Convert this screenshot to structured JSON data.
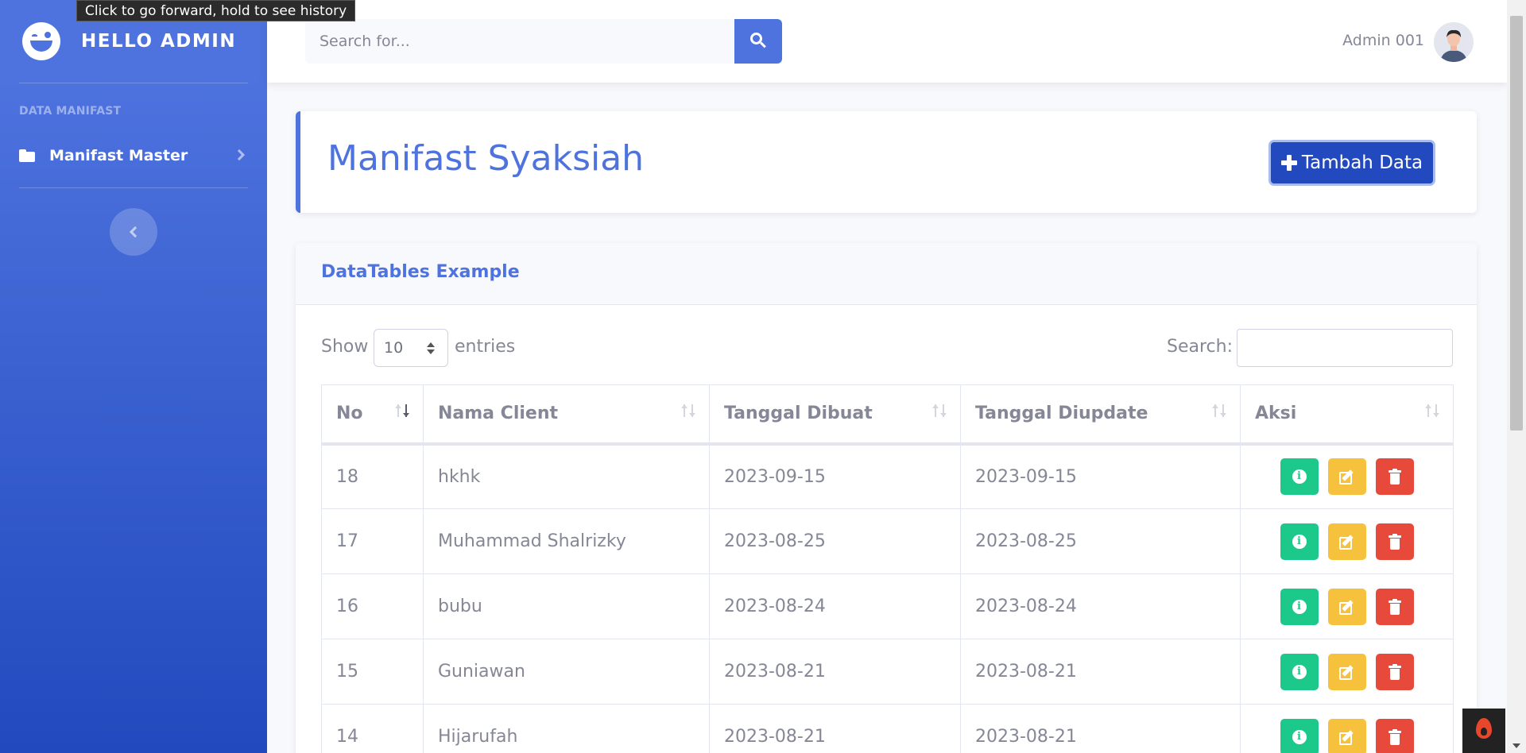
{
  "tooltip": "Click to go forward, hold to see history",
  "sidebar": {
    "brand": "HELLO ADMIN",
    "heading": "DATA MANIFAST",
    "items": [
      {
        "label": "Manifast Master"
      }
    ]
  },
  "topbar": {
    "search_placeholder": "Search for...",
    "user_name": "Admin 001"
  },
  "header": {
    "title": "Manifast Syaksiah",
    "add_button": "Tambah Data"
  },
  "table_card": {
    "title": "DataTables Example",
    "show_label": "Show",
    "entries_value": "10",
    "entries_label": "entries",
    "search_label": "Search:",
    "columns": [
      "No",
      "Nama Client",
      "Tanggal Dibuat",
      "Tanggal Diupdate",
      "Aksi"
    ],
    "rows": [
      {
        "no": "18",
        "nama": "hkhk",
        "dibuat": "2023-09-15",
        "diupdate": "2023-09-15"
      },
      {
        "no": "17",
        "nama": "Muhammad Shalrizky",
        "dibuat": "2023-08-25",
        "diupdate": "2023-08-25"
      },
      {
        "no": "16",
        "nama": "bubu",
        "dibuat": "2023-08-24",
        "diupdate": "2023-08-24"
      },
      {
        "no": "15",
        "nama": "Guniawan",
        "dibuat": "2023-08-21",
        "diupdate": "2023-08-21"
      },
      {
        "no": "14",
        "nama": "Hijarufah",
        "dibuat": "2023-08-21",
        "diupdate": "2023-08-21"
      }
    ],
    "info_icon_glyph": "i"
  },
  "colors": {
    "primary": "#4e73df",
    "success": "#1cc88a",
    "warning": "#f6c23e",
    "danger": "#e74a3b"
  }
}
